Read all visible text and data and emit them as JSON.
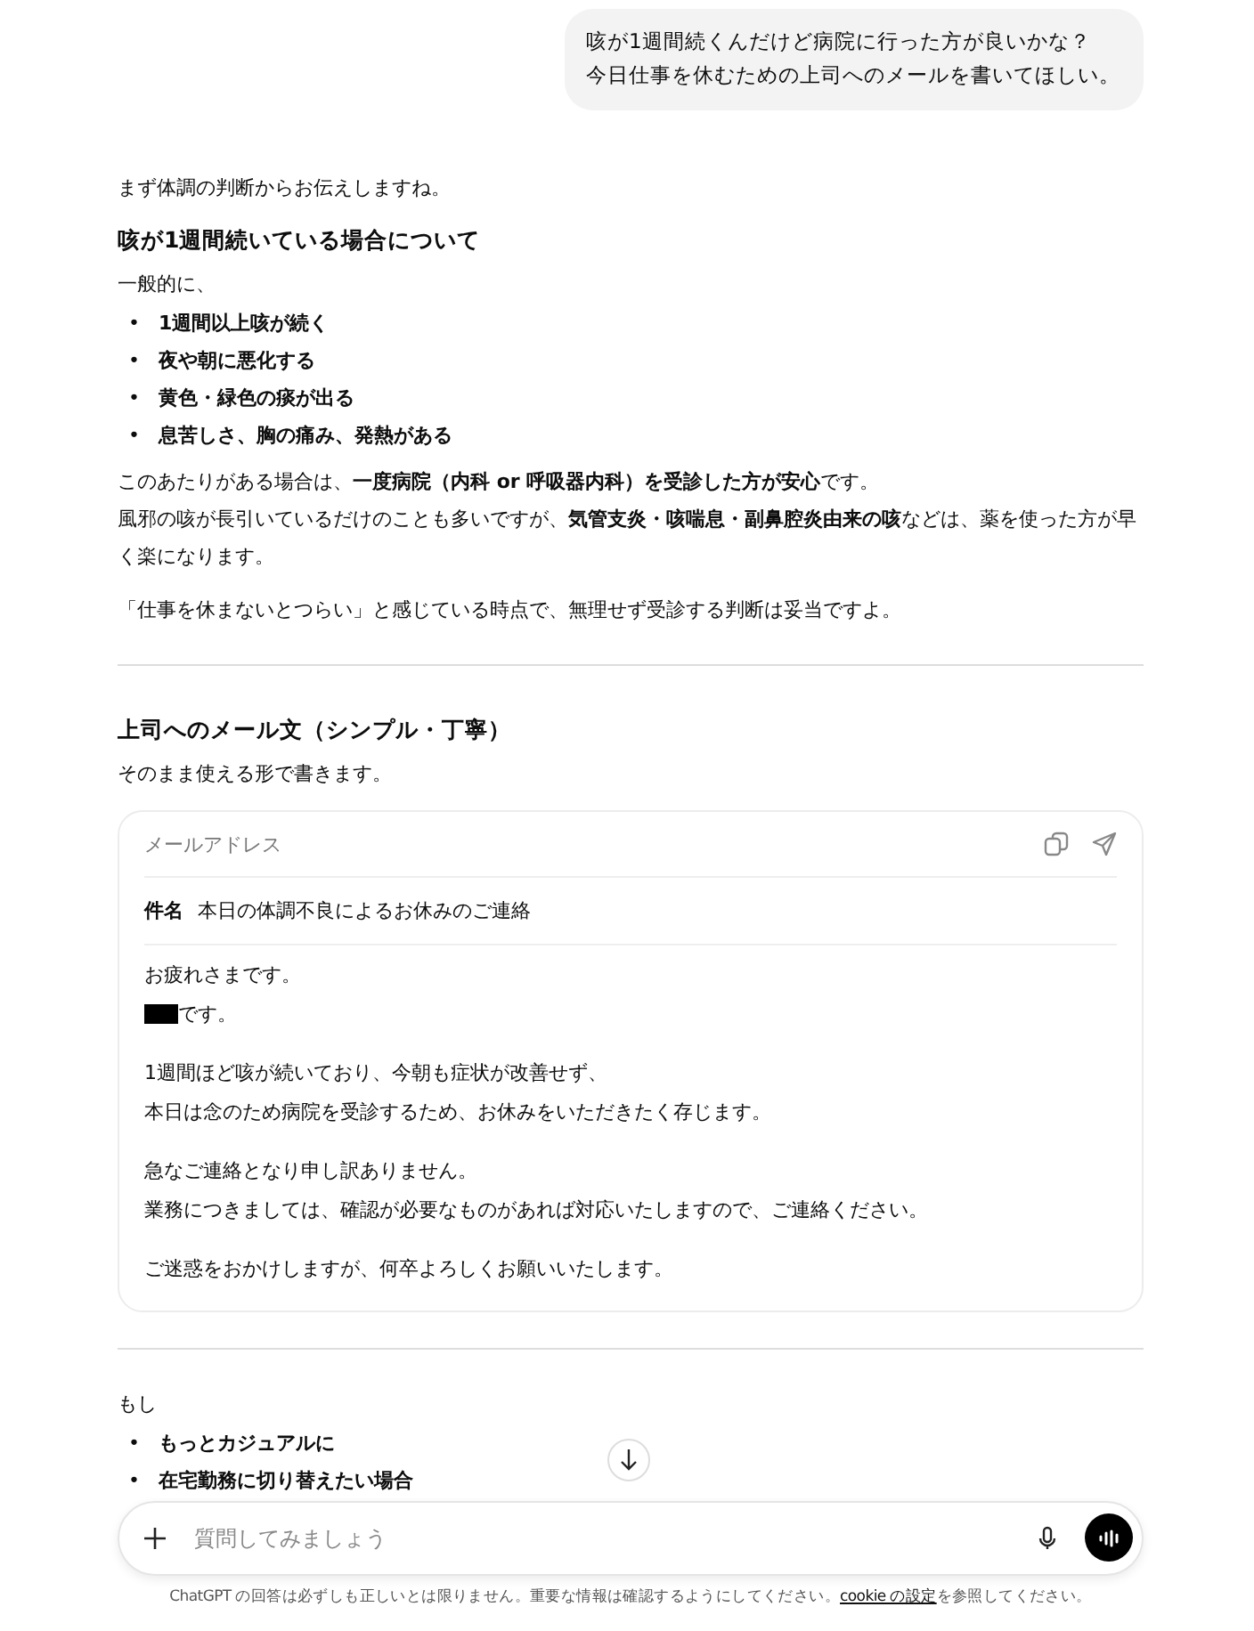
{
  "user_message": {
    "lines": [
      "咳が1週間続くんだけど病院に行った方が良いかな？",
      "今日仕事を休むための上司へのメールを書いてほしい。"
    ]
  },
  "response": {
    "intro": "まず体調の判断からお伝えしますね。",
    "bullet_marker": "•",
    "section_1": {
      "heading": "咳が1週間続いている場合について",
      "lead": "一般的に、",
      "bullets": [
        "1週間以上咳が続く",
        "夜や朝に悪化する",
        "黄色・緑色の痰が出る",
        "息苦しさ、胸の痛み、発熱がある"
      ],
      "paragraphs": [
        {
          "lines": [
            "このあたりがある場合は、**一度病院（内科 or 呼吸器内科）を受診した方が安心**です。",
            "風邪の咳が長引いているだけのことも多いですが、**気管支炎・咳喘息・副鼻腔炎由来の咳**などは、薬を使った方が早く楽になります。"
          ]
        },
        {
          "lines": [
            "「仕事を休まないとつらい」と感じている時点で、無理せず受診する判断は妥当ですよ。"
          ]
        }
      ]
    },
    "section_2": {
      "heading": "上司へのメール文（シンプル・丁寧）",
      "lead": "そのまま使える形で書きます。",
      "email": {
        "header": "メールアドレス",
        "subject_label": "件名",
        "subject": "本日の体調不良によるお休みのご連絡",
        "paragraphs": [
          {
            "lines": [
              "お疲れさまです。"
            ]
          },
          {
            "redacted_prefix": true,
            "lines": [
              "です。"
            ]
          },
          {
            "lines": [
              "1週間ほど咳が続いており、今朝も症状が改善せず、",
              "本日は念のため病院を受診するため、お休みをいただきたく存じます。"
            ]
          },
          {
            "lines": [
              "急なご連絡となり申し訳ありません。",
              "業務につきましては、確認が必要なものがあれば対応いたしますので、ご連絡ください。"
            ]
          },
          {
            "lines": [
              "ご迷惑をおかけしますが、何卒よろしくお願いいたします。"
            ]
          }
        ]
      }
    },
    "section_3": {
      "lead": "もし",
      "bullets": [
        "もっとカジュアルに",
        "在宅勤務に切り替えたい場合"
      ]
    }
  },
  "composer": {
    "placeholder": "質問してみましょう"
  },
  "footer": {
    "text_before": "ChatGPT の回答は必ずしも正しいとは限りません。重要な情報は確認するようにしてください。",
    "link": "cookie の設定",
    "text_after": "を参照してください。"
  }
}
